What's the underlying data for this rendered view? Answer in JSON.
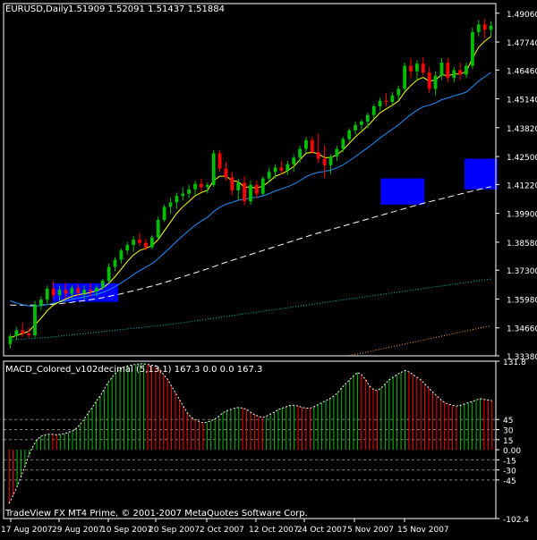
{
  "header": {
    "symbol": "EURUSD,Daily",
    "ohlc": "1.51909 1.52091 1.51437 1.51884"
  },
  "indicator": {
    "title": "MACD_Colored_v102decimal (5,13,1) 167.3 0.0 0.0 167.3"
  },
  "footer": {
    "copyright": "TradeView FX MT4 Prime, © 2001-2007 MetaQuotes Software Corp."
  },
  "colors": {
    "background": "#000000",
    "axis": "#ffffff",
    "bull_candle": "#00c000",
    "bear_candle": "#ff0000",
    "ma_fast": "#ffff00",
    "ma_mid": "#1e90ff",
    "ma_slow": "#ffffff",
    "ma_slower": "#00bfbf",
    "ma_slowest": "#ffa040",
    "highlight_box": "#0000ff",
    "hist_up": "#00c000",
    "hist_down": "#ff0000",
    "hist_level": "#808080"
  },
  "chart_data": [
    {
      "type": "candlestick",
      "title": "EURUSD,Daily",
      "ylim": [
        1.3338,
        1.495
      ],
      "yticks": [
        "1.49060",
        "1.47740",
        "1.46460",
        "1.45140",
        "1.43820",
        "1.42500",
        "1.41220",
        "1.39900",
        "1.38580",
        "1.37300",
        "1.35980",
        "1.34660",
        "1.33380"
      ],
      "xticks": [
        "17 Aug 2007",
        "29 Aug 2007",
        "10 Sep 2007",
        "20 Sep 2007",
        "2 Oct 2007",
        "12 Oct 2007",
        "24 Oct 2007",
        "5 Nov 2007",
        "15 Nov 2007"
      ],
      "candles": [
        [
          1.3392,
          1.3438,
          1.3372,
          1.3428
        ],
        [
          1.3428,
          1.347,
          1.341,
          1.3455
        ],
        [
          1.3455,
          1.349,
          1.3425,
          1.344
        ],
        [
          1.344,
          1.347,
          1.342,
          1.3432
        ],
        [
          1.3432,
          1.359,
          1.342,
          1.357
        ],
        [
          1.357,
          1.361,
          1.3545,
          1.3595
        ],
        [
          1.3595,
          1.366,
          1.3575,
          1.3645
        ],
        [
          1.3645,
          1.368,
          1.36,
          1.3615
        ],
        [
          1.3615,
          1.366,
          1.359,
          1.364
        ],
        [
          1.364,
          1.367,
          1.36,
          1.3622
        ],
        [
          1.3622,
          1.366,
          1.36,
          1.3648
        ],
        [
          1.3648,
          1.3665,
          1.361,
          1.3625
        ],
        [
          1.3625,
          1.366,
          1.3595,
          1.364
        ],
        [
          1.364,
          1.367,
          1.361,
          1.3632
        ],
        [
          1.3632,
          1.366,
          1.361,
          1.365
        ],
        [
          1.365,
          1.369,
          1.364,
          1.3682
        ],
        [
          1.3682,
          1.376,
          1.367,
          1.3745
        ],
        [
          1.3745,
          1.379,
          1.3725,
          1.3778
        ],
        [
          1.3778,
          1.383,
          1.376,
          1.382
        ],
        [
          1.382,
          1.386,
          1.38,
          1.3845
        ],
        [
          1.3845,
          1.3885,
          1.3815,
          1.387
        ],
        [
          1.387,
          1.39,
          1.384,
          1.3855
        ],
        [
          1.3855,
          1.3875,
          1.382,
          1.3835
        ],
        [
          1.3835,
          1.389,
          1.3825,
          1.388
        ],
        [
          1.388,
          1.3975,
          1.387,
          1.396
        ],
        [
          1.396,
          1.403,
          1.395,
          1.402
        ],
        [
          1.402,
          1.406,
          1.399,
          1.404
        ],
        [
          1.404,
          1.4085,
          1.401,
          1.407
        ],
        [
          1.407,
          1.411,
          1.405,
          1.408
        ],
        [
          1.408,
          1.412,
          1.406,
          1.41
        ],
        [
          1.41,
          1.414,
          1.407,
          1.4125
        ],
        [
          1.4125,
          1.415,
          1.409,
          1.411
        ],
        [
          1.411,
          1.413,
          1.408,
          1.412
        ],
        [
          1.412,
          1.428,
          1.411,
          1.4265
        ],
        [
          1.4265,
          1.428,
          1.418,
          1.4195
        ],
        [
          1.4195,
          1.4225,
          1.414,
          1.4155
        ],
        [
          1.4155,
          1.418,
          1.4075,
          1.4095
        ],
        [
          1.4095,
          1.415,
          1.405,
          1.413
        ],
        [
          1.413,
          1.416,
          1.403,
          1.4045
        ],
        [
          1.4045,
          1.414,
          1.403,
          1.412
        ],
        [
          1.412,
          1.414,
          1.406,
          1.408
        ],
        [
          1.408,
          1.416,
          1.407,
          1.415
        ],
        [
          1.415,
          1.42,
          1.413,
          1.418
        ],
        [
          1.418,
          1.4215,
          1.415,
          1.42
        ],
        [
          1.42,
          1.423,
          1.417,
          1.4185
        ],
        [
          1.4185,
          1.423,
          1.4165,
          1.4215
        ],
        [
          1.4215,
          1.426,
          1.418,
          1.4245
        ],
        [
          1.4245,
          1.43,
          1.422,
          1.4285
        ],
        [
          1.4285,
          1.434,
          1.427,
          1.4325
        ],
        [
          1.4325,
          1.434,
          1.426,
          1.427
        ],
        [
          1.427,
          1.4355,
          1.422,
          1.424
        ],
        [
          1.424,
          1.43,
          1.415,
          1.421
        ],
        [
          1.421,
          1.426,
          1.417,
          1.425
        ],
        [
          1.425,
          1.43,
          1.423,
          1.4285
        ],
        [
          1.4285,
          1.434,
          1.427,
          1.433
        ],
        [
          1.433,
          1.438,
          1.432,
          1.437
        ],
        [
          1.437,
          1.441,
          1.435,
          1.4395
        ],
        [
          1.4395,
          1.442,
          1.437,
          1.441
        ],
        [
          1.441,
          1.445,
          1.438,
          1.444
        ],
        [
          1.444,
          1.449,
          1.442,
          1.448
        ],
        [
          1.448,
          1.452,
          1.446,
          1.4505
        ],
        [
          1.4505,
          1.454,
          1.448,
          1.45
        ],
        [
          1.45,
          1.4545,
          1.448,
          1.453
        ],
        [
          1.453,
          1.4575,
          1.451,
          1.456
        ],
        [
          1.456,
          1.468,
          1.455,
          1.4665
        ],
        [
          1.4665,
          1.47,
          1.461,
          1.464
        ],
        [
          1.464,
          1.469,
          1.46,
          1.4675
        ],
        [
          1.4675,
          1.4705,
          1.462,
          1.4635
        ],
        [
          1.4635,
          1.466,
          1.454,
          1.456
        ],
        [
          1.456,
          1.464,
          1.453,
          1.462
        ],
        [
          1.462,
          1.47,
          1.46,
          1.468
        ],
        [
          1.468,
          1.47,
          1.459,
          1.461
        ],
        [
          1.461,
          1.466,
          1.459,
          1.4645
        ],
        [
          1.4645,
          1.468,
          1.46,
          1.4625
        ],
        [
          1.4625,
          1.468,
          1.461,
          1.4665
        ],
        [
          1.4665,
          1.484,
          1.465,
          1.482
        ],
        [
          1.482,
          1.4875,
          1.48,
          1.4855
        ],
        [
          1.4855,
          1.488,
          1.479,
          1.483
        ],
        [
          1.483,
          1.487,
          1.48,
          1.4848
        ]
      ],
      "ma_fast": [
        1.342,
        1.3432,
        1.344,
        1.345,
        1.348,
        1.351,
        1.3545,
        1.357,
        1.3585,
        1.3598,
        1.361,
        1.3618,
        1.3622,
        1.3628,
        1.3635,
        1.3648,
        1.367,
        1.37,
        1.3735,
        1.377,
        1.38,
        1.382,
        1.383,
        1.3842,
        1.387,
        1.391,
        1.395,
        1.399,
        1.402,
        1.4045,
        1.407,
        1.4085,
        1.4095,
        1.414,
        1.416,
        1.416,
        1.414,
        1.4135,
        1.411,
        1.411,
        1.4105,
        1.4115,
        1.4135,
        1.416,
        1.417,
        1.4185,
        1.4205,
        1.4235,
        1.4265,
        1.427,
        1.4262,
        1.4245,
        1.4245,
        1.4258,
        1.428,
        1.431,
        1.434,
        1.4365,
        1.439,
        1.442,
        1.445,
        1.4468,
        1.4485,
        1.4505,
        1.4545,
        1.4575,
        1.46,
        1.4612,
        1.4595,
        1.46,
        1.4625,
        1.462,
        1.4628,
        1.4627,
        1.464,
        1.47,
        1.475,
        1.4778,
        1.48
      ],
      "ma_mid": [
        1.359,
        1.358,
        1.3572,
        1.3566,
        1.3565,
        1.3568,
        1.3572,
        1.3578,
        1.3584,
        1.359,
        1.3596,
        1.3602,
        1.3608,
        1.3614,
        1.362,
        1.3628,
        1.364,
        1.3655,
        1.3672,
        1.369,
        1.371,
        1.3728,
        1.3744,
        1.376,
        1.3782,
        1.3808,
        1.3835,
        1.3862,
        1.3888,
        1.3912,
        1.3935,
        1.3955,
        1.3972,
        1.3998,
        1.4018,
        1.4032,
        1.404,
        1.405,
        1.4055,
        1.406,
        1.4064,
        1.407,
        1.408,
        1.4092,
        1.4102,
        1.4112,
        1.4124,
        1.414,
        1.4158,
        1.417,
        1.4178,
        1.4182,
        1.4188,
        1.4198,
        1.4212,
        1.423,
        1.425,
        1.427,
        1.429,
        1.4312,
        1.4335,
        1.4355,
        1.4375,
        1.4395,
        1.442,
        1.4442,
        1.4462,
        1.4478,
        1.4485,
        1.4495,
        1.451,
        1.4518,
        1.4528,
        1.4535,
        1.4545,
        1.457,
        1.4595,
        1.4615,
        1.4635
      ],
      "ma_slow": [
        1.357,
        1.357,
        1.357,
        1.357,
        1.357,
        1.357,
        1.3572,
        1.3574,
        1.3577,
        1.358,
        1.3583,
        1.3587,
        1.3591,
        1.3595,
        1.3599,
        1.3604,
        1.361,
        1.3616,
        1.3622,
        1.3629,
        1.3636,
        1.3643,
        1.365,
        1.3657,
        1.3665,
        1.3673,
        1.3682,
        1.3691,
        1.37,
        1.3709,
        1.3718,
        1.3727,
        1.3736,
        1.3746,
        1.3756,
        1.3766,
        1.3775,
        1.3784,
        1.3793,
        1.3802,
        1.3811,
        1.382,
        1.3829,
        1.3838,
        1.3847,
        1.3856,
        1.3865,
        1.3874,
        1.3883,
        1.3892,
        1.39,
        1.3908,
        1.3916,
        1.3924,
        1.3932,
        1.394,
        1.3948,
        1.3956,
        1.3964,
        1.3972,
        1.398,
        1.3988,
        1.3996,
        1.4004,
        1.4012,
        1.402,
        1.4028,
        1.4036,
        1.4043,
        1.405,
        1.4057,
        1.4064,
        1.4071,
        1.4078,
        1.4085,
        1.4092,
        1.4099,
        1.4106,
        1.4112
      ],
      "ma_slower": [
        1.341,
        1.3412,
        1.3414,
        1.3416,
        1.3418,
        1.342,
        1.3422,
        1.3425,
        1.3428,
        1.3431,
        1.3434,
        1.3437,
        1.344,
        1.3443,
        1.3446,
        1.3449,
        1.3452,
        1.3455,
        1.3458,
        1.3461,
        1.3464,
        1.3467,
        1.347,
        1.3473,
        1.3476,
        1.3479,
        1.3482,
        1.3486,
        1.349,
        1.3494,
        1.3498,
        1.3502,
        1.3506,
        1.351,
        1.3514,
        1.3518,
        1.3522,
        1.3526,
        1.353,
        1.3534,
        1.3538,
        1.3542,
        1.3546,
        1.355,
        1.3554,
        1.3558,
        1.3562,
        1.3566,
        1.357,
        1.3574,
        1.3578,
        1.3582,
        1.3586,
        1.359,
        1.3594,
        1.3598,
        1.3602,
        1.3606,
        1.361,
        1.3614,
        1.3618,
        1.3622,
        1.3626,
        1.363,
        1.3634,
        1.3638,
        1.3642,
        1.3646,
        1.365,
        1.3654,
        1.3658,
        1.3662,
        1.3666,
        1.367,
        1.3674,
        1.3678,
        1.3682,
        1.3686,
        1.369
      ],
      "ma_slowest": [
        null,
        null,
        null,
        null,
        null,
        null,
        null,
        null,
        null,
        null,
        null,
        null,
        null,
        null,
        null,
        null,
        null,
        null,
        null,
        null,
        null,
        null,
        null,
        null,
        null,
        null,
        null,
        null,
        null,
        null,
        null,
        null,
        null,
        null,
        null,
        null,
        null,
        null,
        null,
        null,
        null,
        null,
        null,
        null,
        null,
        null,
        null,
        null,
        null,
        null,
        null,
        null,
        null,
        null,
        null,
        1.334,
        1.3345,
        1.335,
        1.3356,
        1.3362,
        1.3368,
        1.3374,
        1.338,
        1.3386,
        1.3392,
        1.3398,
        1.3404,
        1.341,
        1.3416,
        1.3422,
        1.3428,
        1.3434,
        1.344,
        1.3446,
        1.3452,
        1.3458,
        1.3464,
        1.347,
        1.3476
      ],
      "highlight_ranges": [
        {
          "from": 9,
          "to": 26,
          "ylow": 1.3585,
          "yhigh": 1.367
        },
        {
          "from": 99,
          "to": 110,
          "ylow": 1.403,
          "yhigh": 1.415
        },
        {
          "from": 122,
          "to": 130,
          "ylow": 1.41,
          "yhigh": 1.424
        }
      ]
    },
    {
      "type": "bar",
      "title": "MACD_Colored_v102decimal (5,13,1) 167.3 0.0 0.0 167.3",
      "ylim": [
        -102.4,
        131.8
      ],
      "yticks": [
        "131.8",
        "45",
        "30",
        "15",
        "0.00",
        "-15",
        "-30",
        "-45",
        "-102.4"
      ],
      "levels": [
        45,
        30,
        15,
        -15,
        -30,
        -45
      ],
      "values": [
        -80,
        -68,
        -55,
        -40,
        -25,
        -8,
        5,
        15,
        20,
        22,
        23,
        23,
        22,
        23,
        24,
        26,
        28,
        32,
        38,
        46,
        55,
        63,
        72,
        80,
        90,
        100,
        108,
        115,
        120,
        123,
        125,
        126,
        127,
        128,
        128,
        127,
        126,
        125,
        120,
        112,
        105,
        95,
        85,
        75,
        65,
        55,
        48,
        45,
        42,
        40,
        41,
        43,
        46,
        50,
        55,
        58,
        60,
        62,
        63,
        62,
        60,
        56,
        52,
        50,
        48,
        50,
        53,
        56,
        60,
        62,
        64,
        66,
        66,
        65,
        63,
        62,
        62,
        64,
        67,
        70,
        73,
        76,
        80,
        85,
        92,
        98,
        104,
        110,
        115,
        112,
        105,
        95,
        90,
        88,
        92,
        98,
        104,
        108,
        112,
        115,
        118,
        116,
        112,
        108,
        104,
        98,
        92,
        86,
        80,
        75,
        70,
        68,
        66,
        65,
        66,
        68,
        70,
        72,
        74,
        76,
        75,
        74,
        73
      ],
      "colors": [
        "d",
        "d",
        "u",
        "u",
        "u",
        "u",
        "u",
        "u",
        "u",
        "u",
        "u",
        "d",
        "d",
        "u",
        "u",
        "u",
        "u",
        "u",
        "u",
        "u",
        "u",
        "u",
        "u",
        "u",
        "u",
        "u",
        "u",
        "u",
        "u",
        "u",
        "u",
        "u",
        "u",
        "u",
        "u",
        "d",
        "d",
        "d",
        "d",
        "d",
        "d",
        "d",
        "d",
        "d",
        "d",
        "d",
        "d",
        "d",
        "d",
        "d",
        "u",
        "u",
        "u",
        "u",
        "u",
        "u",
        "u",
        "u",
        "u",
        "d",
        "d",
        "d",
        "d",
        "d",
        "d",
        "u",
        "u",
        "u",
        "u",
        "u",
        "u",
        "u",
        "u",
        "d",
        "d",
        "d",
        "d",
        "u",
        "u",
        "u",
        "u",
        "u",
        "u",
        "u",
        "u",
        "u",
        "u",
        "u",
        "u",
        "d",
        "d",
        "d",
        "d",
        "d",
        "u",
        "u",
        "u",
        "u",
        "u",
        "u",
        "u",
        "d",
        "d",
        "d",
        "d",
        "d",
        "d",
        "d",
        "d",
        "d",
        "d",
        "d",
        "d",
        "d",
        "u",
        "u",
        "u",
        "u",
        "u",
        "u",
        "d",
        "d",
        "d"
      ]
    }
  ]
}
